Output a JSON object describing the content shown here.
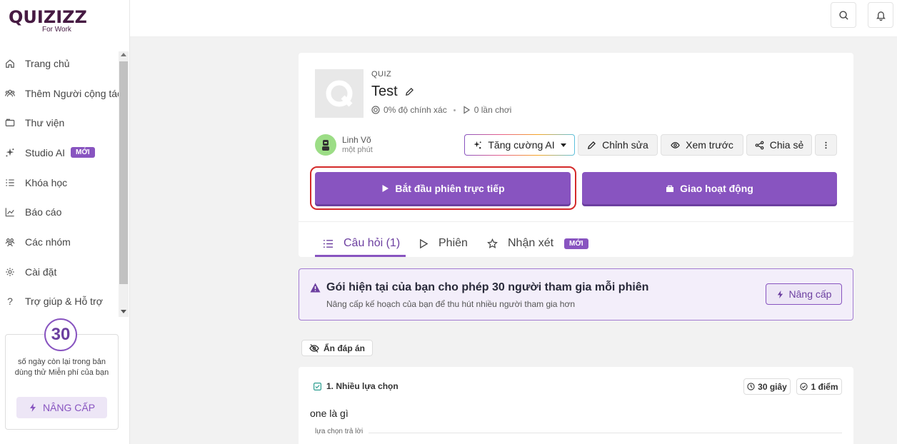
{
  "logo": {
    "brand": "QUIZIZZ",
    "sub": "For Work"
  },
  "sidebar": {
    "items": [
      {
        "label": "Trang chủ",
        "icon": "home-icon"
      },
      {
        "label": "Thêm Người cộng tác",
        "icon": "users-icon"
      },
      {
        "label": "Thư viện",
        "icon": "folder-icon"
      },
      {
        "label": "Studio AI",
        "icon": "sparkle-icon",
        "badge": "MỚI"
      },
      {
        "label": "Khóa học",
        "icon": "list-icon"
      },
      {
        "label": "Báo cáo",
        "icon": "chart-icon"
      },
      {
        "label": "Các nhóm",
        "icon": "group-icon"
      },
      {
        "label": "Cài đặt",
        "icon": "gear-icon"
      },
      {
        "label": "Trợ giúp & Hỗ trợ",
        "icon": "help-icon"
      }
    ],
    "trial": {
      "days": "30",
      "text": "số ngày còn lại trong bản dùng thử Miễn phí của bạn",
      "button": "NÂNG CẤP"
    }
  },
  "quiz": {
    "type": "QUIZ",
    "title": "Test",
    "accuracy": "0% độ chính xác",
    "plays": "0 lần chơi",
    "author": "Linh Võ",
    "time": "một phút"
  },
  "actions": {
    "ai": "Tăng cường AI",
    "edit": "Chỉnh sửa",
    "preview": "Xem trước",
    "share": "Chia sẻ",
    "start_live": "Bắt đầu phiên trực tiếp",
    "assign": "Giao hoạt động"
  },
  "tabs": {
    "questions": "Câu hỏi (1)",
    "sessions": "Phiên",
    "reviews": "Nhận xét",
    "reviews_badge": "MỚI"
  },
  "banner": {
    "title": "Gói hiện tại của bạn cho phép 30 người tham gia mỗi phiên",
    "subtitle": "Nâng cấp kế hoạch của bạn để thu hút nhiều người tham gia hơn",
    "button": "Nâng cấp"
  },
  "hide_answers": "Ẩn đáp án",
  "question": {
    "type": "1. Nhiều lựa chọn",
    "time": "30 giây",
    "points": "1 điểm",
    "text": "one là gì",
    "answers_label": "lựa chọn trả lời"
  },
  "colors": {
    "accent": "#8854c0",
    "highlight": "#d42a2a"
  }
}
